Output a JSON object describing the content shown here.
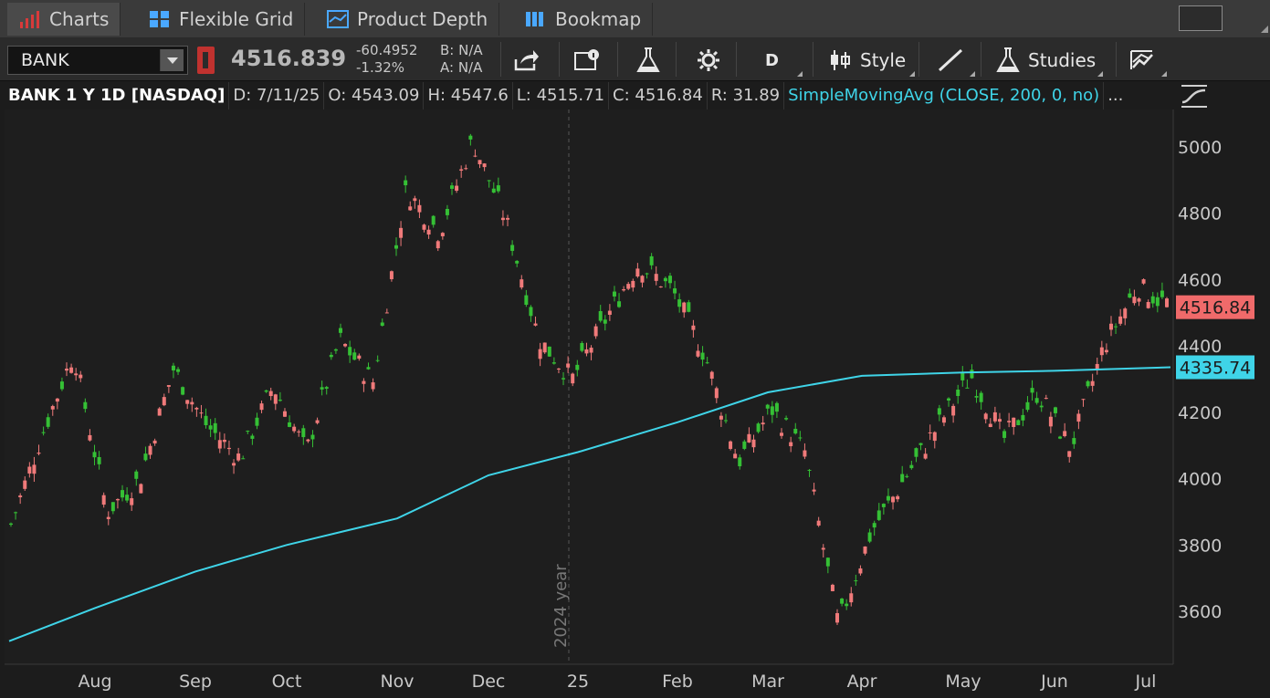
{
  "tabs": [
    {
      "label": "Charts",
      "icon": "bar-chart-icon",
      "active": true
    },
    {
      "label": "Flexible Grid",
      "icon": "grid-icon",
      "active": false
    },
    {
      "label": "Product Depth",
      "icon": "depth-icon",
      "active": false
    },
    {
      "label": "Bookmap",
      "icon": "bookmap-icon",
      "active": false
    }
  ],
  "toolbar": {
    "symbol": "BANK",
    "last_price": "4516.839",
    "net_change": "-60.4952",
    "pct_change": "-1.32%",
    "bid": "B: N/A",
    "ask": "A: N/A",
    "period_label": "D",
    "style_label": "Style",
    "studies_label": "Studies"
  },
  "header": {
    "title": "BANK 1 Y 1D [NASDAQ]",
    "date": "D: 7/11/25",
    "open": "O: 4543.09",
    "high": "H: 4547.6",
    "low": "L: 4515.71",
    "close": "C: 4516.84",
    "range": "R: 31.89",
    "study": "SimpleMovingAvg (CLOSE, 200, 0, no)",
    "ellipsis": "..."
  },
  "colors": {
    "up": "#35c035",
    "down": "#f07a7a",
    "sma": "#3fd4e8",
    "background": "#1c1c1c",
    "grid_text": "#c8c8c8"
  },
  "chart_data": {
    "type": "candlestick",
    "y_ticks": [
      3600,
      3800,
      4000,
      4200,
      4400,
      4600,
      4800,
      5000
    ],
    "ylim": [
      3500,
      5100
    ],
    "x_labels": [
      "Aug",
      "Sep",
      "Oct",
      "Nov",
      "Dec",
      "25",
      "Feb",
      "Mar",
      "Apr",
      "May",
      "Jun",
      "Jul"
    ],
    "year_marker": "2024 year",
    "last_price_label": "4516.84",
    "sma_label": "4335.74",
    "sma_path": [
      {
        "month": "Jul",
        "value": 3510
      },
      {
        "month": "Aug",
        "value": 3610
      },
      {
        "month": "Sep",
        "value": 3720
      },
      {
        "month": "Oct",
        "value": 3800
      },
      {
        "month": "Nov",
        "value": 3880
      },
      {
        "month": "Dec",
        "value": 4010
      },
      {
        "month": "25",
        "value": 4080
      },
      {
        "month": "Feb",
        "value": 4170
      },
      {
        "month": "Mar",
        "value": 4260
      },
      {
        "month": "Apr",
        "value": 4310
      },
      {
        "month": "May",
        "value": 4320
      },
      {
        "month": "Jun",
        "value": 4325
      },
      {
        "month": "Jul",
        "value": 4335.74
      }
    ],
    "price_path": [
      {
        "month": "Jul",
        "value": 3830
      },
      {
        "month": "Jul",
        "value": 4120
      },
      {
        "month": "Aug",
        "value": 4380
      },
      {
        "month": "Aug",
        "value": 3900
      },
      {
        "month": "Aug",
        "value": 4000
      },
      {
        "month": "Sep",
        "value": 4330
      },
      {
        "month": "Sep",
        "value": 4160
      },
      {
        "month": "Sep",
        "value": 4060
      },
      {
        "month": "Oct",
        "value": 4280
      },
      {
        "month": "Oct",
        "value": 4080
      },
      {
        "month": "Oct",
        "value": 4420
      },
      {
        "month": "Nov",
        "value": 4290
      },
      {
        "month": "Nov",
        "value": 4870
      },
      {
        "month": "Nov",
        "value": 4740
      },
      {
        "month": "Dec",
        "value": 5020
      },
      {
        "month": "Dec",
        "value": 4780
      },
      {
        "month": "Dec",
        "value": 4420
      },
      {
        "month": "25",
        "value": 4300
      },
      {
        "month": "25",
        "value": 4480
      },
      {
        "month": "Feb",
        "value": 4650
      },
      {
        "month": "Feb",
        "value": 4570
      },
      {
        "month": "Mar",
        "value": 4370
      },
      {
        "month": "Mar",
        "value": 4050
      },
      {
        "month": "Mar",
        "value": 4210
      },
      {
        "month": "Apr",
        "value": 4080
      },
      {
        "month": "Apr",
        "value": 3560
      },
      {
        "month": "Apr",
        "value": 3840
      },
      {
        "month": "May",
        "value": 4000
      },
      {
        "month": "May",
        "value": 4160
      },
      {
        "month": "May",
        "value": 4310
      },
      {
        "month": "Jun",
        "value": 4120
      },
      {
        "month": "Jun",
        "value": 4260
      },
      {
        "month": "Jun",
        "value": 4090
      },
      {
        "month": "Jul",
        "value": 4400
      },
      {
        "month": "Jul",
        "value": 4580
      },
      {
        "month": "Jul",
        "value": 4516.84
      }
    ]
  }
}
